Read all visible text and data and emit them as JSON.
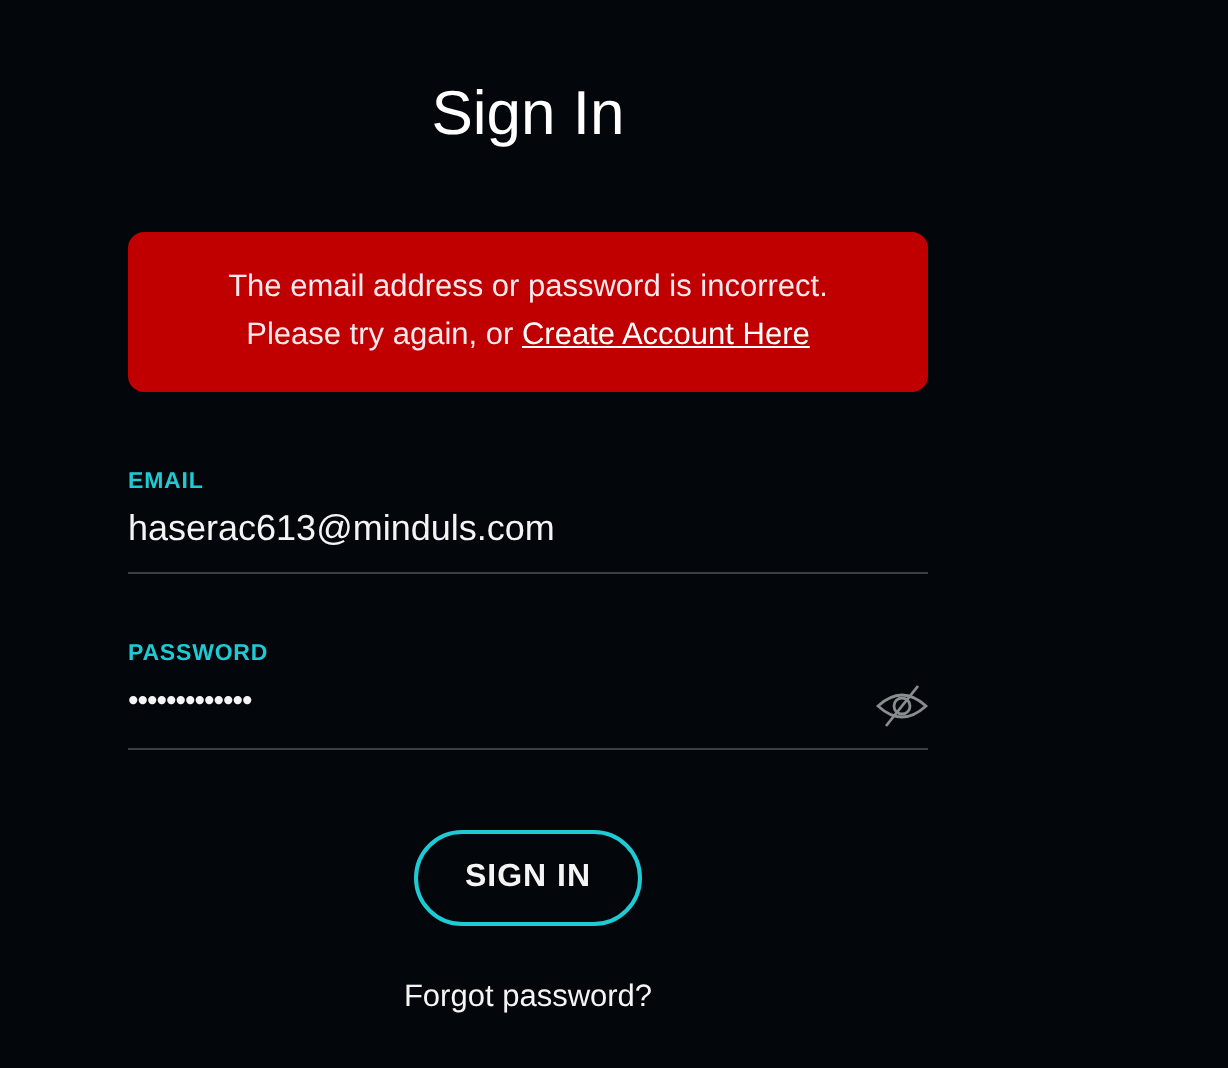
{
  "title": "Sign In",
  "error": {
    "message": "The email address or password is incorrect.",
    "prompt": "Please try again, or ",
    "link": "Create Account Here"
  },
  "email": {
    "label": "EMAIL",
    "value": "haserac613@minduls.com"
  },
  "password": {
    "label": "PASSWORD",
    "value": "•••••••••••••",
    "revealed": false
  },
  "submit": "SIGN IN",
  "forgot": "Forgot password?"
}
